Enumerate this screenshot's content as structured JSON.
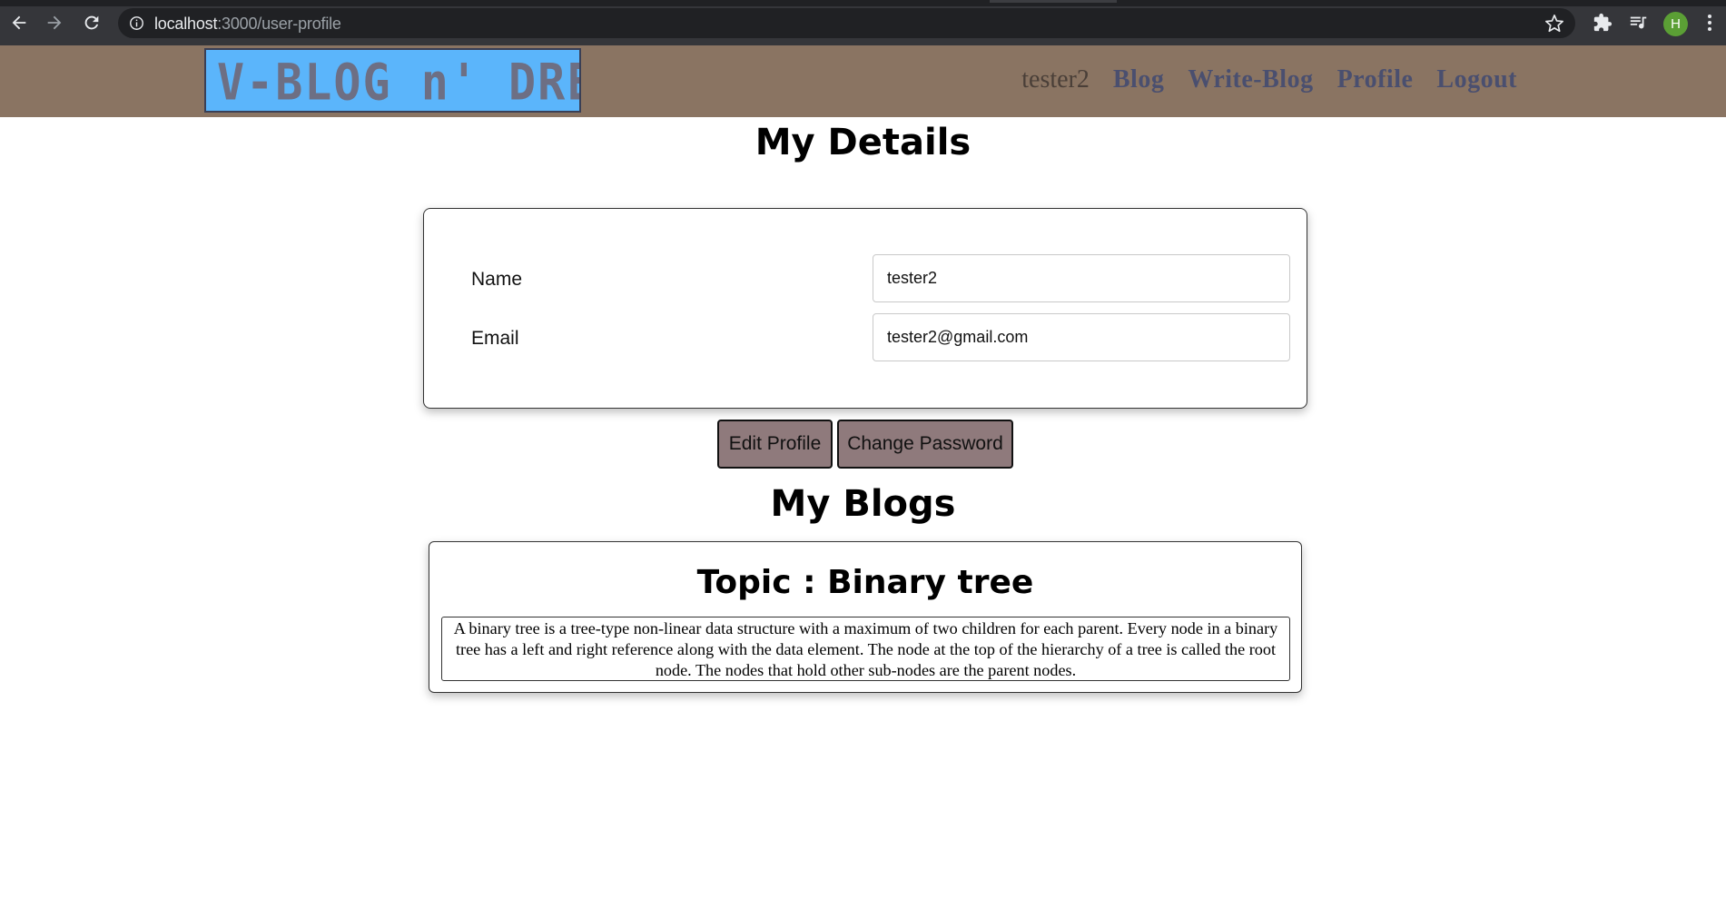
{
  "browser": {
    "url_host": "localhost",
    "url_path": ":3000/user-profile",
    "avatar_letter": "H"
  },
  "navbar": {
    "logo_text": "V-BLOG n' DREAM",
    "username": "tester2",
    "links": [
      "Blog",
      "Write-Blog",
      "Profile",
      "Logout"
    ]
  },
  "details": {
    "heading": "My Details",
    "name_label": "Name",
    "name_value": "tester2",
    "email_label": "Email",
    "email_value": "tester2@gmail.com"
  },
  "actions": {
    "edit_profile": "Edit Profile",
    "change_password": "Change Password"
  },
  "blogs": {
    "heading": "My Blogs",
    "items": [
      {
        "topic": "Topic : Binary tree",
        "body": "A binary tree is a tree-type non-linear data structure with a maximum of two children for each parent. Every node in a binary tree has a left and right reference along with the data element. The node at the top of the hierarchy of a tree is called the root node. The nodes that hold other sub-nodes are the parent nodes."
      }
    ]
  },
  "colors": {
    "navbar_bg": "#8a7462",
    "logo_bg": "#5bb5fb",
    "nav_link": "#4a4f6f",
    "button_bg": "#8f7a7c"
  }
}
